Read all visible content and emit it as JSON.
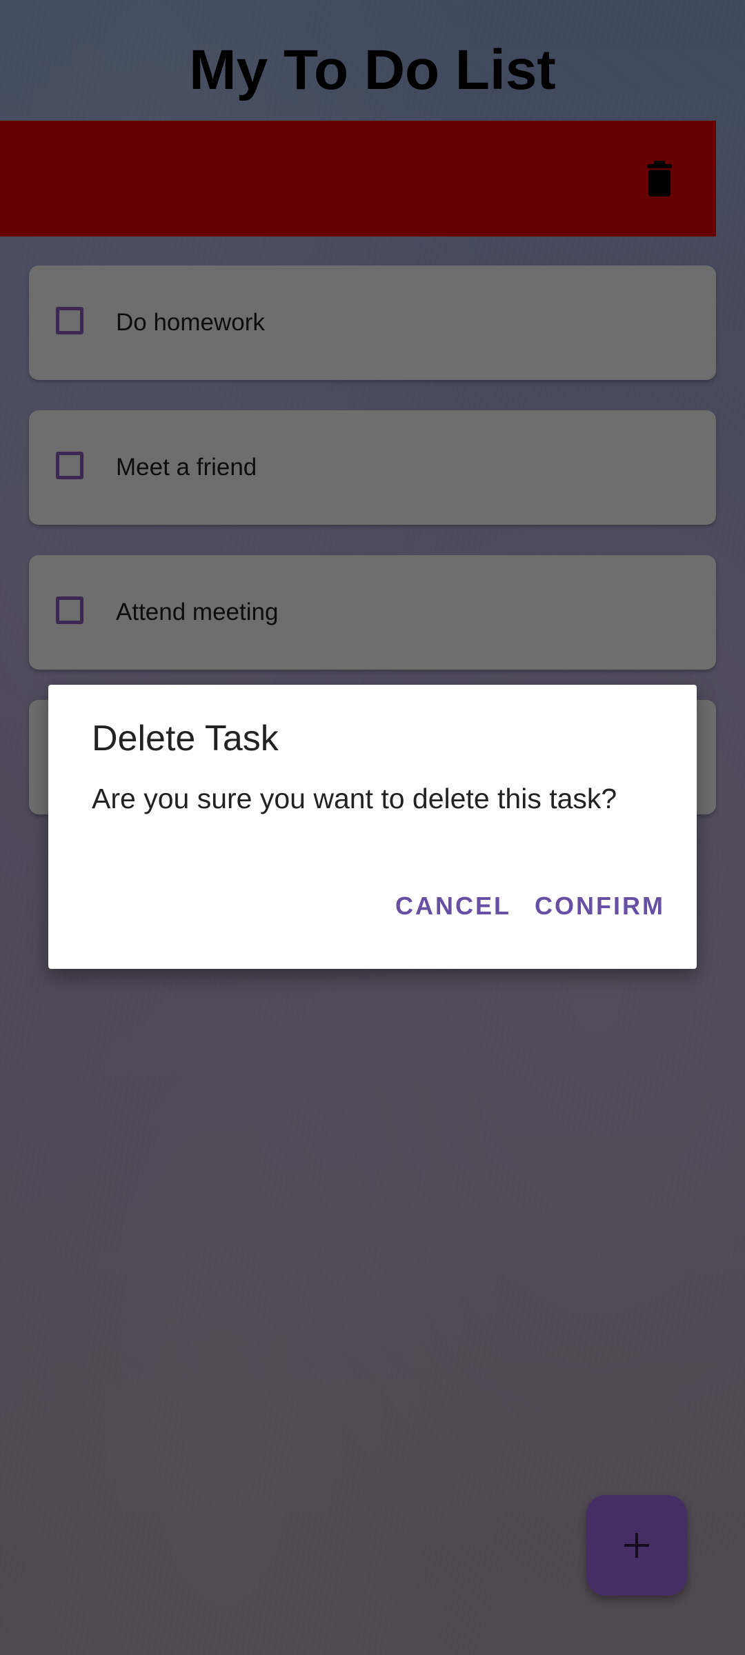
{
  "app": {
    "title": "My To Do List"
  },
  "swipe_row": {
    "background_color": "#cc0000",
    "icon": "trash-icon"
  },
  "tasks": [
    {
      "label": "Do homework",
      "checked": false
    },
    {
      "label": "Meet a friend",
      "checked": false
    },
    {
      "label": "Attend meeting",
      "checked": false
    }
  ],
  "dialog": {
    "title": "Delete Task",
    "message": "Are you sure you want to delete this task?",
    "cancel_label": "CANCEL",
    "confirm_label": "CONFIRM"
  },
  "fab": {
    "icon": "plus-icon",
    "color": "#8a5cc9"
  },
  "colors": {
    "accent": "#6750a4",
    "checkbox_border": "#7a4fa6"
  }
}
